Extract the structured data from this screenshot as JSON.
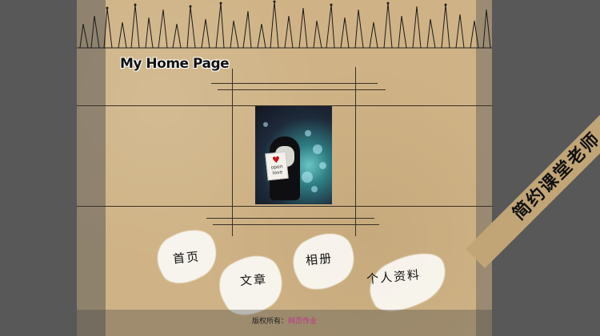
{
  "header": {
    "title": "My Home Page"
  },
  "photo": {
    "card_text_line1": "open",
    "card_text_line2": "love"
  },
  "nav": {
    "items": [
      {
        "label": "首页"
      },
      {
        "label": "文章"
      },
      {
        "label": "相册"
      },
      {
        "label": "个人资料"
      }
    ]
  },
  "footer": {
    "copyright_prefix": "版权所有：",
    "copyright_link": "网页作业"
  },
  "watermark": {
    "text": "简约课堂老师"
  },
  "colors": {
    "background": "#5a5a5a",
    "paper": "#cfb386",
    "link": "#c0308f",
    "ribbon": "#c2a576"
  }
}
